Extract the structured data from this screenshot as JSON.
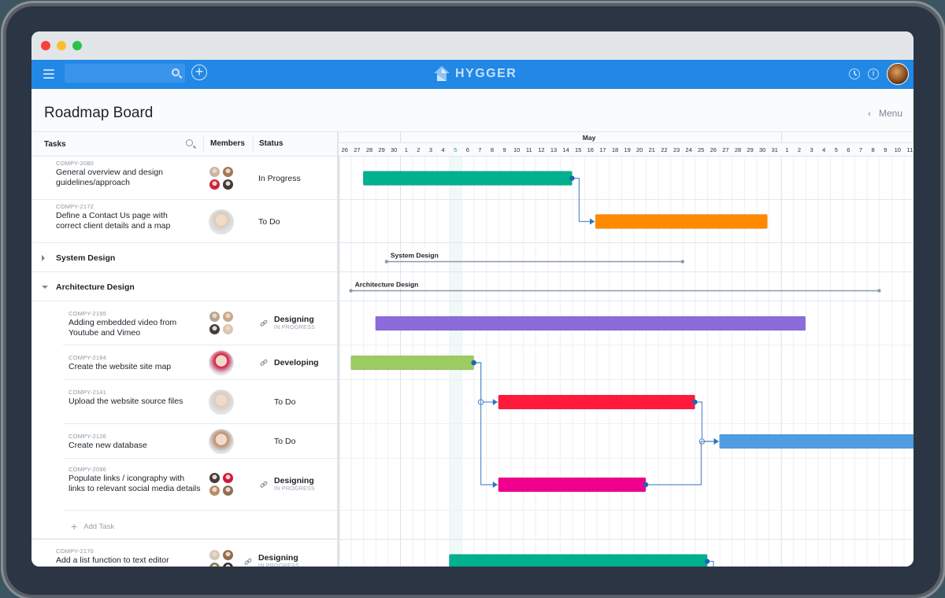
{
  "window": {
    "traffic_lights": [
      "close",
      "minimize",
      "maximize"
    ]
  },
  "appbar": {
    "search_placeholder": "",
    "logo_text": "HYGGER",
    "icons": [
      "menu-icon",
      "search-icon",
      "add-icon",
      "clock-icon",
      "info-icon",
      "user-avatar"
    ],
    "info_glyph": "i",
    "add_glyph": "+"
  },
  "page": {
    "title": "Roadmap Board",
    "menu_label": "Menu",
    "menu_chevron": "‹"
  },
  "columns": {
    "tasks": "Tasks",
    "members": "Members",
    "status": "Status"
  },
  "timeline": {
    "months": [
      {
        "label": "May",
        "start_day_index": 5,
        "days": 31
      }
    ],
    "days": [
      "26",
      "27",
      "28",
      "29",
      "30",
      "1",
      "2",
      "3",
      "4",
      "5",
      "6",
      "7",
      "8",
      "9",
      "10",
      "11",
      "12",
      "13",
      "14",
      "15",
      "16",
      "17",
      "18",
      "19",
      "20",
      "21",
      "22",
      "23",
      "24",
      "25",
      "26",
      "27",
      "28",
      "29",
      "30",
      "31",
      "1",
      "2",
      "3",
      "4",
      "5",
      "6",
      "7",
      "8",
      "9",
      "10",
      "11"
    ],
    "today_index": 9,
    "colors": {
      "grid": "#edf0f3",
      "month_divider": "#dde1e5",
      "today_band": "#f0f9f8",
      "connector": "#5b8fcf",
      "connector_dot": "#1f66b3",
      "group_line": "#8b9aa7"
    }
  },
  "rows": [
    {
      "type": "task",
      "id": "COMPY-2080",
      "title": "General overview and design guidelines/approach",
      "members": 4,
      "status": "In Progress",
      "status_sub": "",
      "linked": false,
      "bar": {
        "start": 2.0,
        "end": 19.0,
        "color": "#00b08f"
      }
    },
    {
      "type": "task",
      "id": "COMPY-2172",
      "title": "Define a Contact Us page with correct client details and a map",
      "members": 1,
      "status": "To Do",
      "status_sub": "",
      "linked": false,
      "bar": {
        "start": 20.9,
        "end": 34.9,
        "color": "#ff8a00"
      }
    },
    {
      "type": "group",
      "title": "System Design",
      "expanded": false,
      "bar": {
        "start": 3.9,
        "end": 28.0,
        "label": "System Design"
      }
    },
    {
      "type": "group",
      "title": "Architecture Design",
      "expanded": true,
      "bar": {
        "start": 1.0,
        "end": 44.0,
        "label": "Architecture Design"
      }
    },
    {
      "type": "subtask",
      "id": "COMPY-2195",
      "title": "Adding embedded video from Youtube and Vimeo",
      "members": 4,
      "status": "Designing",
      "status_sub": "IN PROGRESS",
      "linked": true,
      "bar": {
        "start": 3.0,
        "end": 38.0,
        "color": "#8c6bdc"
      }
    },
    {
      "type": "subtask",
      "id": "COMPY-2184",
      "title": "Create the website site map",
      "members": 1,
      "status": "Developing",
      "status_sub": "",
      "linked": true,
      "bar": {
        "start": 1.0,
        "end": 11.0,
        "color": "#9ccb62"
      }
    },
    {
      "type": "subtask",
      "id": "COMPY-2141",
      "title": "Upload the website source files",
      "members": 1,
      "status": "To Do",
      "status_sub": "",
      "linked": false,
      "bar": {
        "start": 13.0,
        "end": 29.0,
        "color": "#ff1a3c"
      }
    },
    {
      "type": "subtask",
      "id": "COMPY-2126",
      "title": "Create new database",
      "members": 1,
      "status": "To Do",
      "status_sub": "",
      "linked": false,
      "bar": {
        "start": 31.0,
        "end": 47.5,
        "color": "#4f9de0"
      }
    },
    {
      "type": "subtask",
      "id": "COMPY-2096",
      "title": "Populate links / icongraphy with links to relevant social media details",
      "members": 4,
      "status": "Designing",
      "status_sub": "IN PROGRESS",
      "linked": true,
      "bar": {
        "start": 13.0,
        "end": 25.0,
        "color": "#f0008c"
      }
    },
    {
      "type": "add",
      "label": "Add Task",
      "glyph": "+"
    },
    {
      "type": "task",
      "id": "COMPY-2170",
      "title": "Add a list function to text editor",
      "members": 4,
      "status": "Designing",
      "status_sub": "IN PROGRESS",
      "linked": true,
      "bar": {
        "start": 9.0,
        "end": 30.0,
        "color": "#00b08f"
      }
    }
  ],
  "dependencies": [
    {
      "from": 0,
      "to": 1
    },
    {
      "from": 5,
      "to": 6
    },
    {
      "from": 5,
      "to": 8
    },
    {
      "from": 6,
      "to": 7
    },
    {
      "from": 8,
      "to": 7
    },
    {
      "from": 10,
      "to": null
    }
  ],
  "link_glyph": "🔗"
}
